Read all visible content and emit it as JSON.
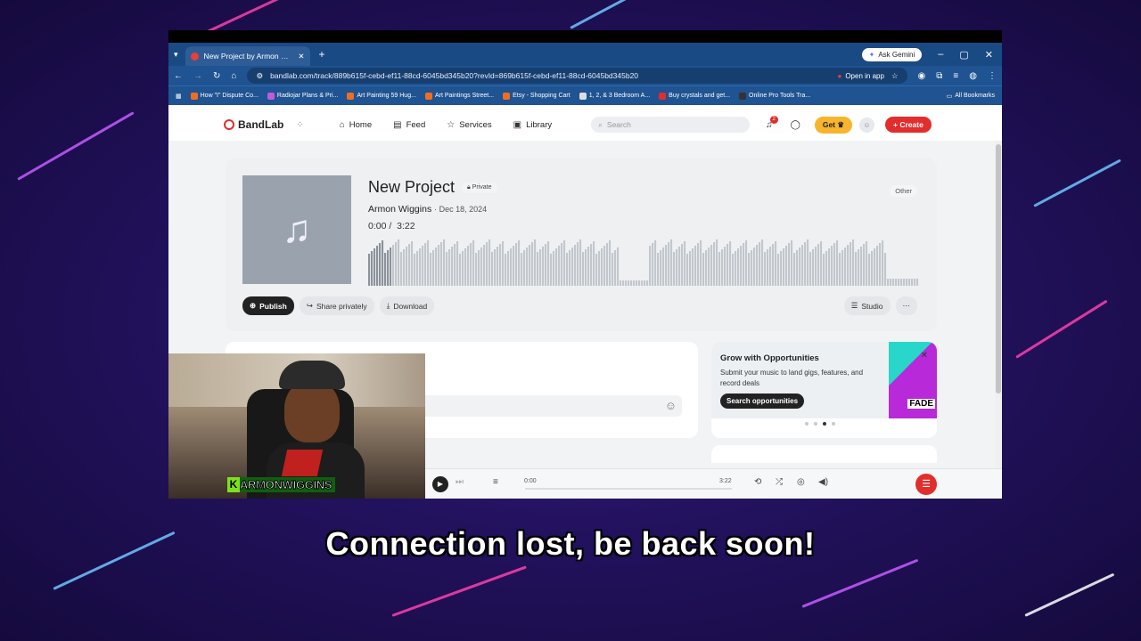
{
  "browser": {
    "tab_title": "New Project by Armon Wiggins",
    "ask_gemini": "Ask Gemini",
    "url": "bandlab.com/track/889b615f-cebd-ef11-88cd-6045bd345b20?revId=869b615f-cebd-ef11-88cd-6045bd345b20",
    "open_in_app": "Open in app",
    "bookmarks": [
      "How \"I\" Dispute Co...",
      "Radiojar Plans & Pri...",
      "Art Painting 59 Hug...",
      "Art Paintings Street...",
      "Etsy - Shopping Cart",
      "1, 2, & 3 Bedroom A...",
      "Buy crystals and get...",
      "Online Pro Tools Tra..."
    ],
    "all_bookmarks": "All Bookmarks"
  },
  "nav": {
    "logo": "BandLab",
    "links": [
      "Home",
      "Feed",
      "Services",
      "Library"
    ],
    "search_placeholder": "Search",
    "notification_count": "2",
    "get_label": "Get",
    "create_label": "Create"
  },
  "project": {
    "title": "New Project",
    "privacy": "Private",
    "genre": "Other",
    "author": "Armon Wiggins",
    "date": "Dec 18, 2024",
    "current_time": "0:00",
    "duration": "3:22",
    "played_fraction": 0.04,
    "actions": {
      "publish": "Publish",
      "share_privately": "Share privately",
      "download": "Download",
      "studio": "Studio"
    }
  },
  "opportunities": {
    "title": "Grow with Opportunities",
    "body": "Submit your music to land gigs, features, and record deals",
    "button": "Search opportunities",
    "brand": "FADE",
    "active_dot": 2
  },
  "player": {
    "current": "0:00",
    "duration": "3:22"
  },
  "webcam": {
    "name_tag": "ARMONWIGGINS",
    "tag_letter": "K"
  },
  "caption": "Connection lost, be back soon!"
}
